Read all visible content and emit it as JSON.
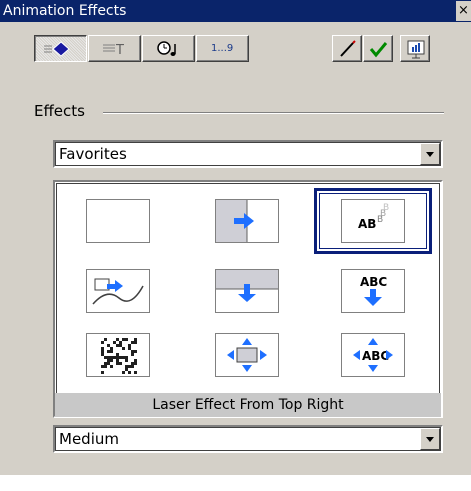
{
  "window": {
    "title": "Animation Effects",
    "close_label": "×"
  },
  "toolbar": {
    "number_label": "1...9"
  },
  "effects_group": {
    "label": "Effects"
  },
  "category_select": {
    "value": "Favorites"
  },
  "effect_grid": {
    "items": [
      "blank",
      "fly-from-right",
      "laser-from-top-right",
      "drive-in",
      "drop-in",
      "text-drop",
      "dissolve",
      "flash-outward",
      "text-explode"
    ],
    "selected_index": 2,
    "status_text": "Laser Effect From Top Right"
  },
  "speed_select": {
    "value": "Medium"
  },
  "colors": {
    "accent": "#0a246a",
    "arrow_blue": "#1e6fff",
    "face": "#d4d0c8"
  }
}
